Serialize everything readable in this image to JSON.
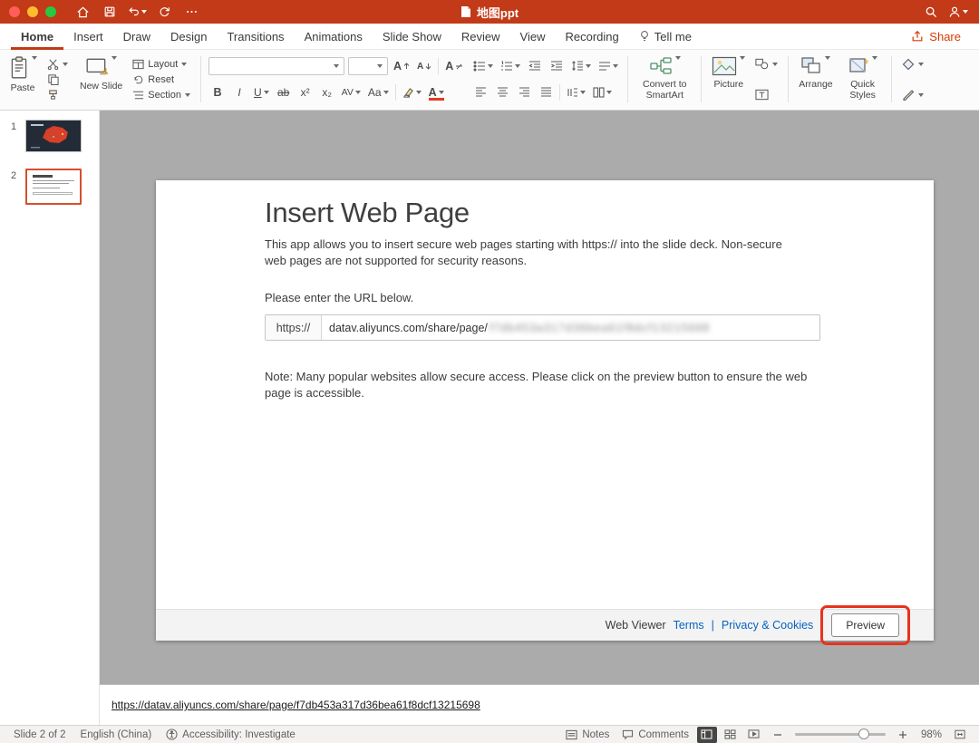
{
  "titlebar": {
    "title": "地图ppt"
  },
  "tabs": [
    "Home",
    "Insert",
    "Draw",
    "Design",
    "Transitions",
    "Animations",
    "Slide Show",
    "Review",
    "View",
    "Recording",
    "Tell me"
  ],
  "share_label": "Share",
  "ribbon": {
    "paste": "Paste",
    "new_slide": "New Slide",
    "layout": "Layout",
    "reset": "Reset",
    "section": "Section",
    "convert_smartart": "Convert to SmartArt",
    "picture": "Picture",
    "arrange": "Arrange",
    "quick_styles": "Quick Styles",
    "format": {
      "bold": "B",
      "italic": "I",
      "underline": "U",
      "strike": "ab",
      "superscript": "x²",
      "subscript": "x₂",
      "spacing": "AV",
      "case": "Aa",
      "fontcolor": "A"
    }
  },
  "thumbnails": [
    {
      "number": "1"
    },
    {
      "number": "2"
    }
  ],
  "slide": {
    "title": "Insert Web Page",
    "description": "This app allows you to insert secure web pages starting with https:// into the slide deck. Non-secure web pages are not supported for security reasons.",
    "url_prompt": "Please enter the URL below.",
    "url_prefix": "https://",
    "url_visible": "datav.aliyuncs.com/share/page/",
    "url_blurred": "f7db453a317d36bea61f8dcf13215698",
    "note": "Note: Many popular websites allow secure access. Please click on the preview button to ensure the web page is accessible.",
    "footer_label": "Web Viewer",
    "footer_terms": "Terms",
    "footer_sep": "|",
    "footer_privacy": "Privacy & Cookies",
    "preview_button": "Preview"
  },
  "notes_url": "https://datav.aliyuncs.com/share/page/f7db453a317d36bea61f8dcf13215698",
  "statusbar": {
    "slide_info": "Slide 2 of 2",
    "language": "English (China)",
    "accessibility": "Accessibility: Investigate",
    "notes": "Notes",
    "comments": "Comments",
    "zoom_percent": "98%"
  },
  "colors": {
    "titlebar_bg": "#c23a18",
    "accent_red": "#e8321e",
    "link_blue": "#0563c1",
    "selected_thumb_border": "#d4502e"
  }
}
